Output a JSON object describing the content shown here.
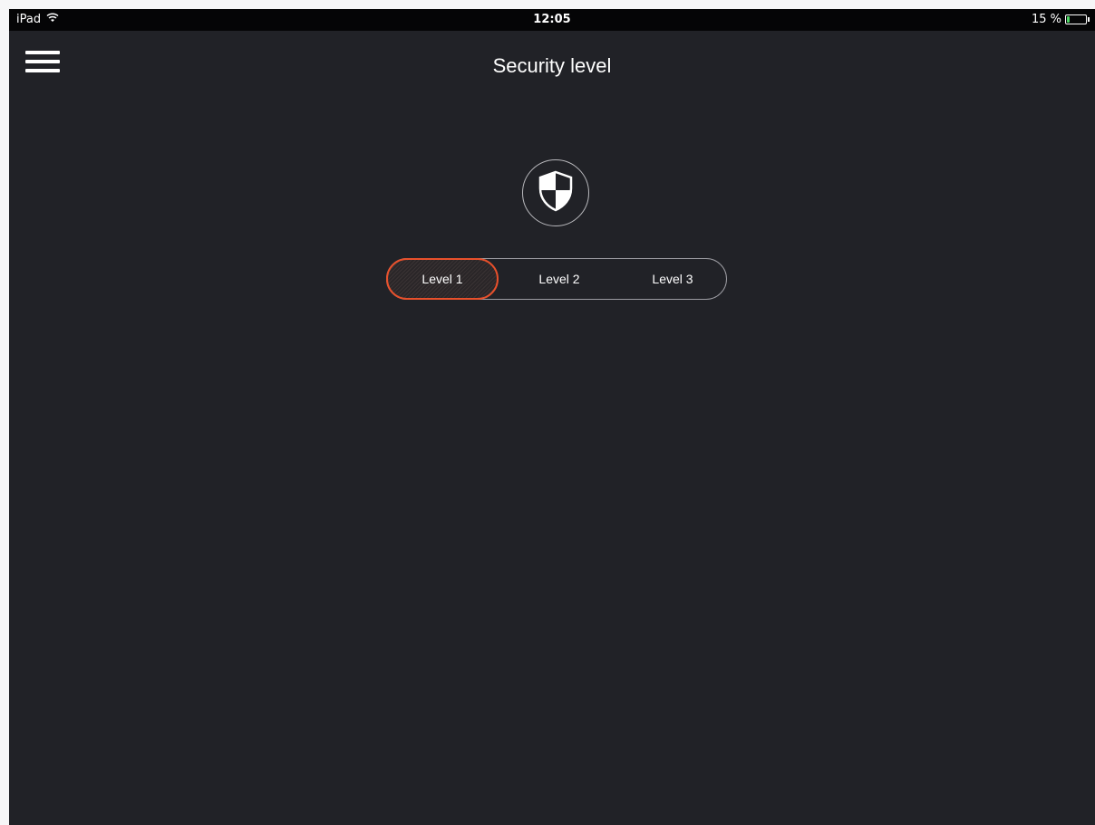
{
  "status_bar": {
    "device": "iPad",
    "time": "12:05",
    "battery_text": "15 %",
    "battery_level": 0.15,
    "icons": [
      "wifi-icon",
      "battery-icon"
    ]
  },
  "header": {
    "title": "Security level",
    "menu_icon": "hamburger-menu-icon"
  },
  "security": {
    "icon": "shield-icon",
    "levels": [
      {
        "label": "Level 1",
        "selected": true
      },
      {
        "label": "Level 2",
        "selected": false
      },
      {
        "label": "Level 3",
        "selected": false
      }
    ]
  },
  "colors": {
    "background": "#212227",
    "accent": "#e8502b",
    "text": "#ffffff",
    "status_bar": "#050506"
  }
}
